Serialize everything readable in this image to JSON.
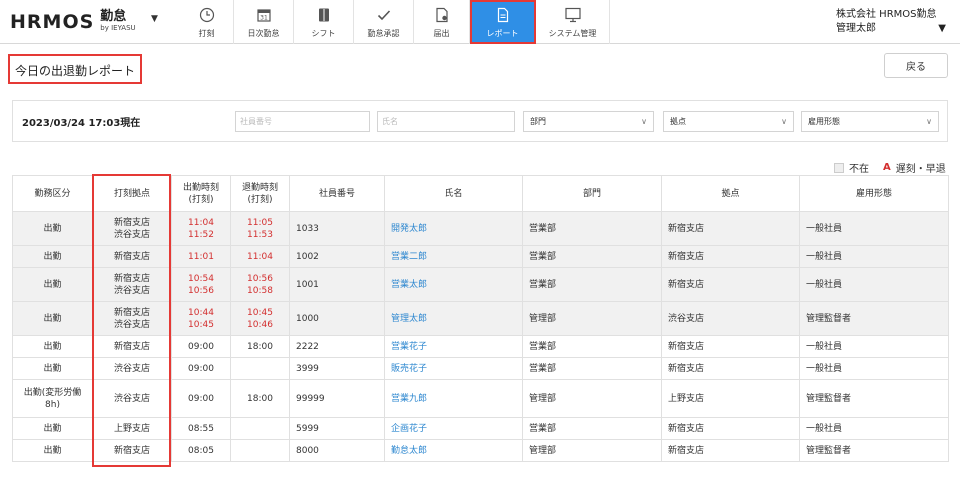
{
  "header": {
    "logo_main": "HRMOS",
    "logo_kana": "勤怠",
    "logo_sub": "by IEYASU",
    "nav": [
      {
        "label": "打刻",
        "icon": "clock-icon"
      },
      {
        "label": "日次勤怠",
        "icon": "calendar-icon"
      },
      {
        "label": "シフト",
        "icon": "shift-icon"
      },
      {
        "label": "勤怠承認",
        "icon": "check-icon"
      },
      {
        "label": "届出",
        "icon": "document-icon"
      },
      {
        "label": "レポート",
        "icon": "report-icon",
        "active": true
      },
      {
        "label": "システム管理",
        "icon": "monitor-icon"
      }
    ],
    "company": "株式会社 HRMOS勤怠",
    "user": "管理太郎"
  },
  "page": {
    "title": "今日の出退勤レポート",
    "back_label": "戻る"
  },
  "filter": {
    "timestamp": "2023/03/24 17:03現在",
    "employee_no_placeholder": "社員番号",
    "name_placeholder": "氏名",
    "dept_label": "部門",
    "office_label": "拠点",
    "employment_label": "雇用形態"
  },
  "legend": {
    "absent": "不在",
    "late_mark": "A",
    "late": "遅刻・早退"
  },
  "colors": {
    "accent": "#2f8fe6",
    "highlight": "#e53935",
    "late": "#d32f2f",
    "link": "#2f88d0",
    "shade": "#f1f1f1"
  },
  "table": {
    "headers": {
      "type": "勤務区分",
      "office": "打刻拠点",
      "in_l1": "出勤時刻",
      "in_l2": "(打刻)",
      "out_l1": "退勤時刻",
      "out_l2": "(打刻)",
      "empno": "社員番号",
      "name": "氏名",
      "dept": "部門",
      "base": "拠点",
      "emp": "雇用形態"
    },
    "rows": [
      {
        "type": "出勤",
        "office1": "新宿支店",
        "office2": "渋谷支店",
        "in1": "11:04",
        "in2": "11:52",
        "out1": "11:05",
        "out2": "11:53",
        "empno": "1033",
        "name": "開発太郎",
        "dept": "営業部",
        "base": "新宿支店",
        "emp": "一般社員"
      },
      {
        "type": "出勤",
        "office1": "新宿支店",
        "office2": "",
        "in1": "11:01",
        "in2": "",
        "out1": "11:04",
        "out2": "",
        "empno": "1002",
        "name": "営業二郎",
        "dept": "営業部",
        "base": "新宿支店",
        "emp": "一般社員"
      },
      {
        "type": "出勤",
        "office1": "新宿支店",
        "office2": "渋谷支店",
        "in1": "10:54",
        "in2": "10:56",
        "out1": "10:56",
        "out2": "10:58",
        "empno": "1001",
        "name": "営業太郎",
        "dept": "営業部",
        "base": "新宿支店",
        "emp": "一般社員"
      },
      {
        "type": "出勤",
        "office1": "新宿支店",
        "office2": "渋谷支店",
        "in1": "10:44",
        "in2": "10:45",
        "out1": "10:45",
        "out2": "10:46",
        "empno": "1000",
        "name": "管理太郎",
        "dept": "管理部",
        "base": "渋谷支店",
        "emp": "管理監督者"
      },
      {
        "type": "出勤",
        "office1": "新宿支店",
        "office2": "",
        "in1": "09:00",
        "in2": "",
        "out1": "18:00",
        "out2": "",
        "empno": "2222",
        "name": "営業花子",
        "dept": "営業部",
        "base": "新宿支店",
        "emp": "一般社員"
      },
      {
        "type": "出勤",
        "office1": "渋谷支店",
        "office2": "",
        "in1": "09:00",
        "in2": "",
        "out1": "",
        "out2": "",
        "empno": "3999",
        "name": "販売花子",
        "dept": "営業部",
        "base": "新宿支店",
        "emp": "一般社員"
      },
      {
        "type": "出勤(変形労働8h)",
        "office1": "渋谷支店",
        "office2": "",
        "in1": "09:00",
        "in2": "",
        "out1": "18:00",
        "out2": "",
        "empno": "99999",
        "name": "営業九郎",
        "dept": "管理部",
        "base": "上野支店",
        "emp": "管理監督者"
      },
      {
        "type": "出勤",
        "office1": "上野支店",
        "office2": "",
        "in1": "08:55",
        "in2": "",
        "out1": "",
        "out2": "",
        "empno": "5999",
        "name": "企画花子",
        "dept": "営業部",
        "base": "新宿支店",
        "emp": "一般社員"
      },
      {
        "type": "出勤",
        "office1": "新宿支店",
        "office2": "",
        "in1": "08:05",
        "in2": "",
        "out1": "",
        "out2": "",
        "empno": "8000",
        "name": "勤怠太郎",
        "dept": "管理部",
        "base": "新宿支店",
        "emp": "管理監督者"
      }
    ]
  }
}
